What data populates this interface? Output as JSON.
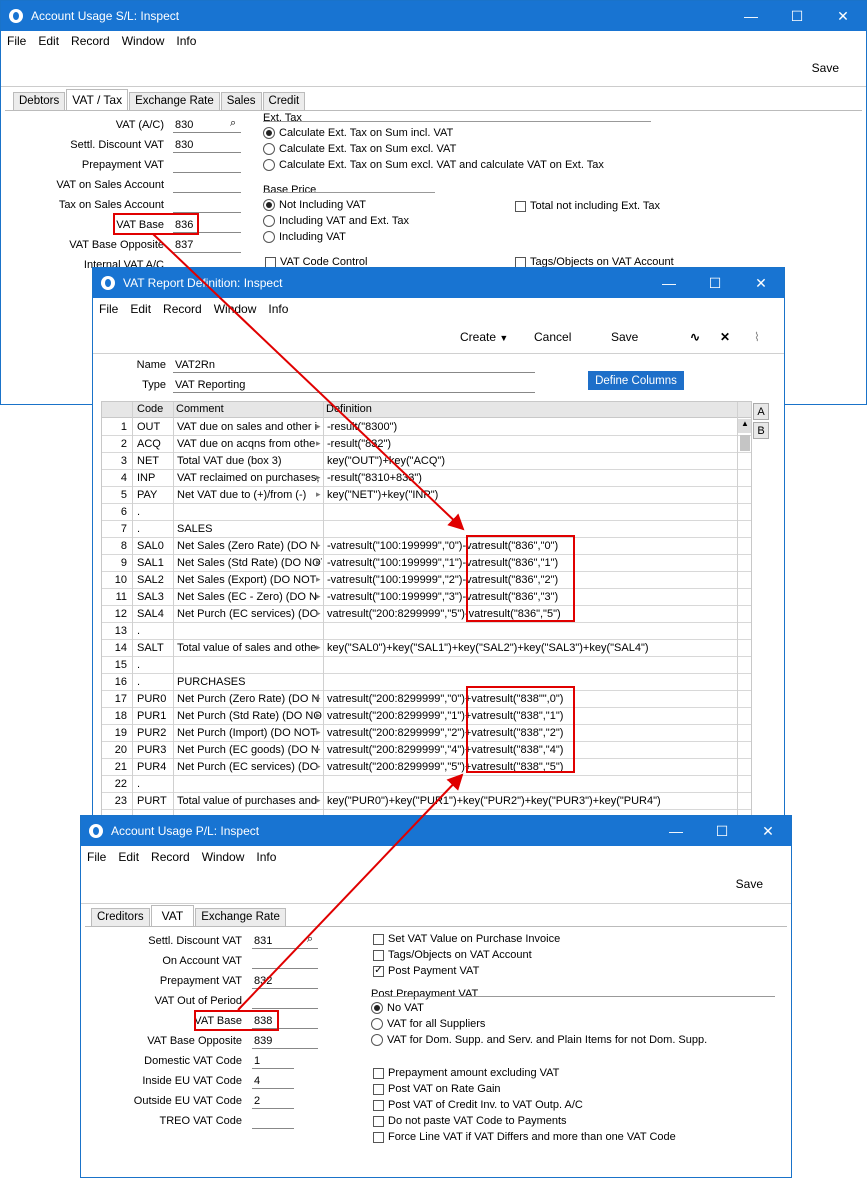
{
  "win1": {
    "title": "Account Usage S/L: Inspect",
    "menu": [
      "File",
      "Edit",
      "Record",
      "Window",
      "Info"
    ],
    "save": "Save",
    "tabs": [
      "Debtors",
      "VAT / Tax",
      "Exchange Rate",
      "Sales",
      "Credit"
    ],
    "fields": [
      {
        "label": "VAT (A/C)",
        "value": "830"
      },
      {
        "label": "Settl. Discount VAT",
        "value": "830"
      },
      {
        "label": "Prepayment VAT",
        "value": ""
      },
      {
        "label": "VAT on Sales Account",
        "value": ""
      },
      {
        "label": "Tax on Sales Account",
        "value": ""
      },
      {
        "label": "VAT Base",
        "value": "836"
      },
      {
        "label": "VAT Base Opposite",
        "value": "837"
      },
      {
        "label": "Internal VAT A/C",
        "value": ""
      }
    ],
    "ext_tax_title": "Ext. Tax",
    "ext_tax_options": [
      "Calculate Ext. Tax on Sum incl. VAT",
      "Calculate Ext. Tax on Sum excl. VAT",
      "Calculate Ext. Tax on Sum excl. VAT and calculate VAT on Ext. Tax"
    ],
    "base_price_title": "Base Price",
    "base_price_options": [
      "Not Including VAT",
      "Including VAT and Ext. Tax",
      "Including VAT"
    ],
    "total_not_incl": "Total not including Ext. Tax",
    "vat_code_control": "VAT Code Control",
    "tags_objects": "Tags/Objects on VAT Account"
  },
  "win2": {
    "title": "VAT Report Definition: Inspect",
    "menu": [
      "File",
      "Edit",
      "Record",
      "Window",
      "Info"
    ],
    "create": "Create",
    "cancel": "Cancel",
    "save": "Save",
    "name_label": "Name",
    "name_value": "VAT2Rn",
    "type_label": "Type",
    "type_value": "VAT Reporting",
    "define_columns": "Define Columns",
    "side_a": "A",
    "side_b": "B",
    "columns": [
      "Code",
      "Comment",
      "Definition"
    ],
    "rows": [
      {
        "n": "1",
        "code": "OUT",
        "comment": "VAT due on sales and other i",
        "def": "-result(\"8300\")"
      },
      {
        "n": "2",
        "code": "ACQ",
        "comment": "VAT due on acqns from othe",
        "def": "-result(\"832\")"
      },
      {
        "n": "3",
        "code": "NET",
        "comment": "Total VAT due (box 3)",
        "def": "key(\"OUT\")+key(\"ACQ\")"
      },
      {
        "n": "4",
        "code": "INP",
        "comment": "VAT reclaimed on purchases,",
        "def": "-result(\"8310+833\")"
      },
      {
        "n": "5",
        "code": "PAY",
        "comment": "Net VAT due to (+)/from (-)",
        "def": "key(\"NET\")+key(\"INP\")"
      },
      {
        "n": "6",
        "code": ".",
        "comment": "",
        "def": ""
      },
      {
        "n": "7",
        "code": ".",
        "comment": "SALES",
        "def": ""
      },
      {
        "n": "8",
        "code": "SAL0",
        "comment": "Net Sales (Zero Rate)  (DO N",
        "def": "-vatresult(\"100:199999\",\"0\")-vatresult(\"836\",\"0\")"
      },
      {
        "n": "9",
        "code": "SAL1",
        "comment": "Net Sales (Std Rate)  (DO NOT",
        "def": "-vatresult(\"100:199999\",\"1\")-vatresult(\"836\",\"1\")"
      },
      {
        "n": "10",
        "code": "SAL2",
        "comment": "Net Sales (Export)  (DO NOT",
        "def": "-vatresult(\"100:199999\",\"2\")-vatresult(\"836\",\"2\")"
      },
      {
        "n": "11",
        "code": "SAL3",
        "comment": "Net Sales (EC - Zero)  (DO N",
        "def": "-vatresult(\"100:199999\",\"3\")-vatresult(\"836\",\"3\")"
      },
      {
        "n": "12",
        "code": "SAL4",
        "comment": "Net Purch (EC services)  (DO",
        "def": "vatresult(\"200:8299999\",\"5\")-vatresult(\"836\",\"5\")"
      },
      {
        "n": "13",
        "code": ".",
        "comment": "",
        "def": ""
      },
      {
        "n": "14",
        "code": "SALT",
        "comment": "Total value of sales and othe",
        "def": "key(\"SAL0\")+key(\"SAL1\")+key(\"SAL2\")+key(\"SAL3\")+key(\"SAL4\")"
      },
      {
        "n": "15",
        "code": ".",
        "comment": "",
        "def": ""
      },
      {
        "n": "16",
        "code": ".",
        "comment": "PURCHASES",
        "def": ""
      },
      {
        "n": "17",
        "code": "PUR0",
        "comment": "Net Purch (Zero Rate)  (DO N",
        "def": "vatresult(\"200:8299999\",\"0\")+vatresult(\"838\"\",0\")"
      },
      {
        "n": "18",
        "code": "PUR1",
        "comment": "Net Purch (Std Rate)  (DO NO",
        "def": "vatresult(\"200:8299999\",\"1\")+vatresult(\"838\",\"1\")"
      },
      {
        "n": "19",
        "code": "PUR2",
        "comment": "Net Purch (Import)  (DO NOT",
        "def": "vatresult(\"200:8299999\",\"2\")+vatresult(\"838\",\"2\")"
      },
      {
        "n": "20",
        "code": "PUR3",
        "comment": "Net Purch (EC goods)  (DO N",
        "def": "vatresult(\"200:8299999\",\"4\")+vatresult(\"838\",\"4\")"
      },
      {
        "n": "21",
        "code": "PUR4",
        "comment": "Net Purch (EC services)  (DO",
        "def": "vatresult(\"200:8299999\",\"5\")+vatresult(\"838\",\"5\")"
      },
      {
        "n": "22",
        "code": ".",
        "comment": "",
        "def": ""
      },
      {
        "n": "23",
        "code": "PURT",
        "comment": "Total value of purchases and",
        "def": "key(\"PUR0\")+key(\"PUR1\")+key(\"PUR2\")+key(\"PUR3\")+key(\"PUR4\")"
      }
    ]
  },
  "win3": {
    "title": "Account Usage P/L: Inspect",
    "menu": [
      "File",
      "Edit",
      "Record",
      "Window",
      "Info"
    ],
    "save": "Save",
    "tabs": [
      "Creditors",
      "VAT",
      "Exchange Rate"
    ],
    "fields": [
      {
        "label": "Settl. Discount VAT",
        "value": "831"
      },
      {
        "label": "On Account VAT",
        "value": ""
      },
      {
        "label": "Prepayment VAT",
        "value": "832"
      },
      {
        "label": "VAT Out of Period",
        "value": ""
      },
      {
        "label": "VAT Base",
        "value": "838"
      },
      {
        "label": "VAT Base Opposite",
        "value": "839"
      },
      {
        "label": "Domestic VAT Code",
        "value": "1"
      },
      {
        "label": "Inside EU VAT Code",
        "value": "4"
      },
      {
        "label": "Outside EU VAT Code",
        "value": "2"
      },
      {
        "label": "TREO VAT Code",
        "value": ""
      }
    ],
    "checks1": [
      {
        "label": "Set VAT Value on Purchase Invoice",
        "checked": false
      },
      {
        "label": "Tags/Objects on VAT Account",
        "checked": false
      },
      {
        "label": "Post Payment VAT",
        "checked": true
      }
    ],
    "post_prepayment_title": "Post Prepayment VAT",
    "radios": [
      {
        "label": "No VAT",
        "on": true
      },
      {
        "label": "VAT for all Suppliers",
        "on": false
      },
      {
        "label": "VAT for Dom. Supp. and Serv. and Plain Items for not Dom. Supp.",
        "on": false
      }
    ],
    "checks2": [
      {
        "label": "Prepayment amount excluding VAT",
        "checked": false
      },
      {
        "label": "Post VAT on Rate Gain",
        "checked": false
      },
      {
        "label": "Post VAT of Credit Inv. to VAT Outp. A/C",
        "checked": false
      },
      {
        "label": "Do not paste VAT Code to Payments",
        "checked": false
      },
      {
        "label": "Force Line VAT if VAT Differs and more than one VAT Code",
        "checked": false
      }
    ]
  }
}
